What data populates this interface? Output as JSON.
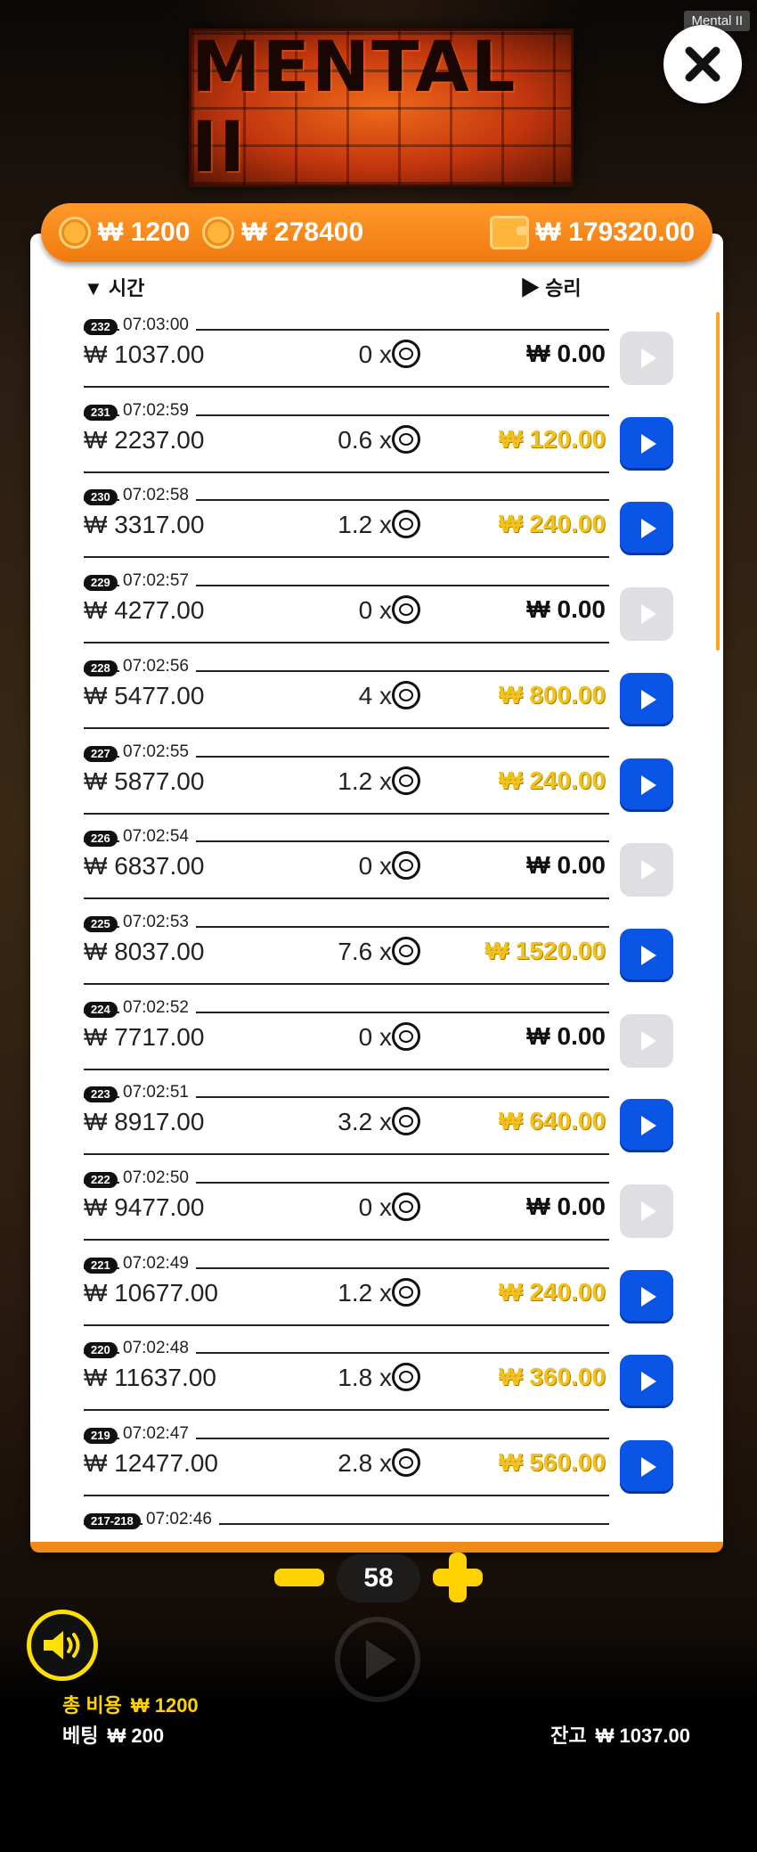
{
  "app_tag": "Mental II",
  "logo_text": "MENTAL II",
  "stats": {
    "bet_amount": "₩ 1200",
    "coin_amount": "₩ 278400",
    "wallet_amount": "₩ 179320.00"
  },
  "columns": {
    "time": "시간",
    "win": "승리"
  },
  "rows": [
    {
      "id": "232",
      "time": "07:03:00",
      "bet": "₩ 1037.00",
      "mult": "0 x",
      "win": "₩ 0.00",
      "active": false
    },
    {
      "id": "231",
      "time": "07:02:59",
      "bet": "₩ 2237.00",
      "mult": "0.6 x",
      "win": "₩ 120.00",
      "active": true
    },
    {
      "id": "230",
      "time": "07:02:58",
      "bet": "₩ 3317.00",
      "mult": "1.2 x",
      "win": "₩ 240.00",
      "active": true
    },
    {
      "id": "229",
      "time": "07:02:57",
      "bet": "₩ 4277.00",
      "mult": "0 x",
      "win": "₩ 0.00",
      "active": false
    },
    {
      "id": "228",
      "time": "07:02:56",
      "bet": "₩ 5477.00",
      "mult": "4 x",
      "win": "₩ 800.00",
      "active": true
    },
    {
      "id": "227",
      "time": "07:02:55",
      "bet": "₩ 5877.00",
      "mult": "1.2 x",
      "win": "₩ 240.00",
      "active": true
    },
    {
      "id": "226",
      "time": "07:02:54",
      "bet": "₩ 6837.00",
      "mult": "0 x",
      "win": "₩ 0.00",
      "active": false
    },
    {
      "id": "225",
      "time": "07:02:53",
      "bet": "₩ 8037.00",
      "mult": "7.6 x",
      "win": "₩ 1520.00",
      "active": true
    },
    {
      "id": "224",
      "time": "07:02:52",
      "bet": "₩ 7717.00",
      "mult": "0 x",
      "win": "₩ 0.00",
      "active": false
    },
    {
      "id": "223",
      "time": "07:02:51",
      "bet": "₩ 8917.00",
      "mult": "3.2 x",
      "win": "₩ 640.00",
      "active": true
    },
    {
      "id": "222",
      "time": "07:02:50",
      "bet": "₩ 9477.00",
      "mult": "0 x",
      "win": "₩ 0.00",
      "active": false
    },
    {
      "id": "221",
      "time": "07:02:49",
      "bet": "₩ 10677.00",
      "mult": "1.2 x",
      "win": "₩ 240.00",
      "active": true
    },
    {
      "id": "220",
      "time": "07:02:48",
      "bet": "₩ 11637.00",
      "mult": "1.8 x",
      "win": "₩ 360.00",
      "active": true
    },
    {
      "id": "219",
      "time": "07:02:47",
      "bet": "₩ 12477.00",
      "mult": "2.8 x",
      "win": "₩ 560.00",
      "active": true
    },
    {
      "id": "217-218",
      "time": "07:02:46",
      "bet": "",
      "mult": "",
      "win": "",
      "active": false
    }
  ],
  "controls": {
    "count": "58"
  },
  "footer": {
    "total_label": "총 비용",
    "total_value": "₩ 1200",
    "bet_label": "베팅",
    "bet_value": "₩ 200",
    "balance_label": "잔고",
    "balance_value": "₩ 1037.00"
  },
  "colors": {
    "accent": "#f08a18",
    "play_active": "#0b55e6",
    "win_gold": "#f2c21a",
    "sound_ring": "#ffe100"
  }
}
